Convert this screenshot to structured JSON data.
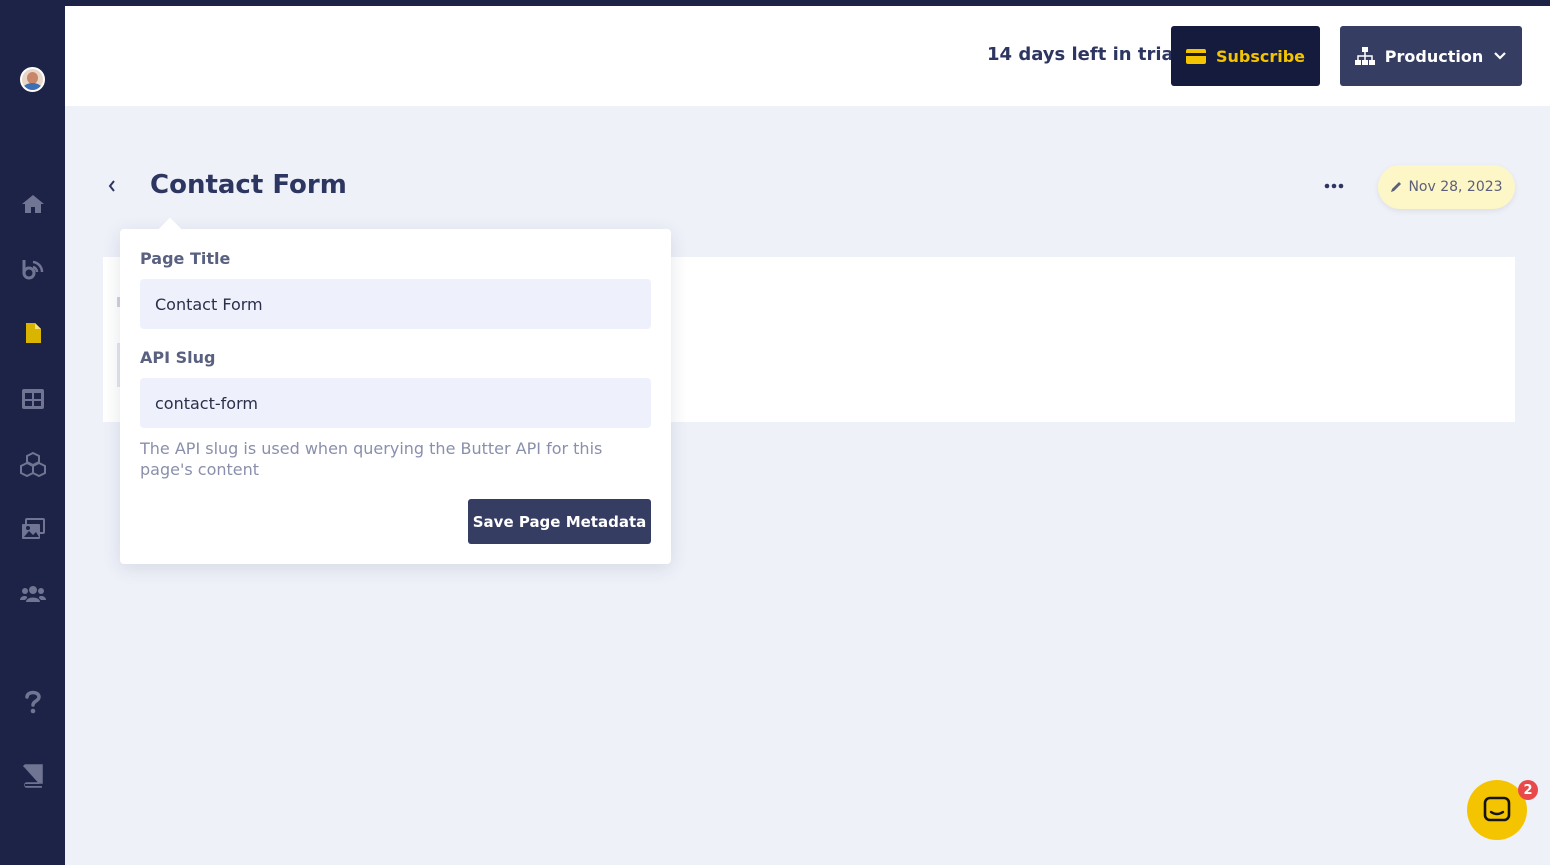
{
  "sidebar": {
    "avatar_alt": "User avatar",
    "items": [
      {
        "name": "home",
        "icon": "home-icon"
      },
      {
        "name": "blog",
        "icon": "blog-icon"
      },
      {
        "name": "pages",
        "icon": "page-icon",
        "active": true
      },
      {
        "name": "collections",
        "icon": "table-icon"
      },
      {
        "name": "components",
        "icon": "cubes-icon"
      },
      {
        "name": "media",
        "icon": "media-icon"
      },
      {
        "name": "users",
        "icon": "users-icon"
      },
      {
        "name": "help",
        "icon": "question-icon"
      },
      {
        "name": "docs",
        "icon": "book-icon"
      }
    ]
  },
  "header": {
    "trial_text": "14 days left in trial",
    "subscribe_label": "Subscribe",
    "environment_label": "Production"
  },
  "page": {
    "title": "Contact Form",
    "date": "Nov 28, 2023"
  },
  "metadata_popover": {
    "page_title_label": "Page Title",
    "page_title_value": "Contact Form",
    "api_slug_label": "API Slug",
    "api_slug_value": "contact-form",
    "help_text": "The API slug is used when querying the Butter API for this page's content",
    "save_label": "Save Page Metadata"
  },
  "chat": {
    "badge_count": "2"
  },
  "colors": {
    "sidebar_bg": "#1c2346",
    "accent_yellow": "#f5c400",
    "primary_button": "#363d62",
    "page_bg": "#eef1f8",
    "badge_red": "#e84a4a"
  }
}
